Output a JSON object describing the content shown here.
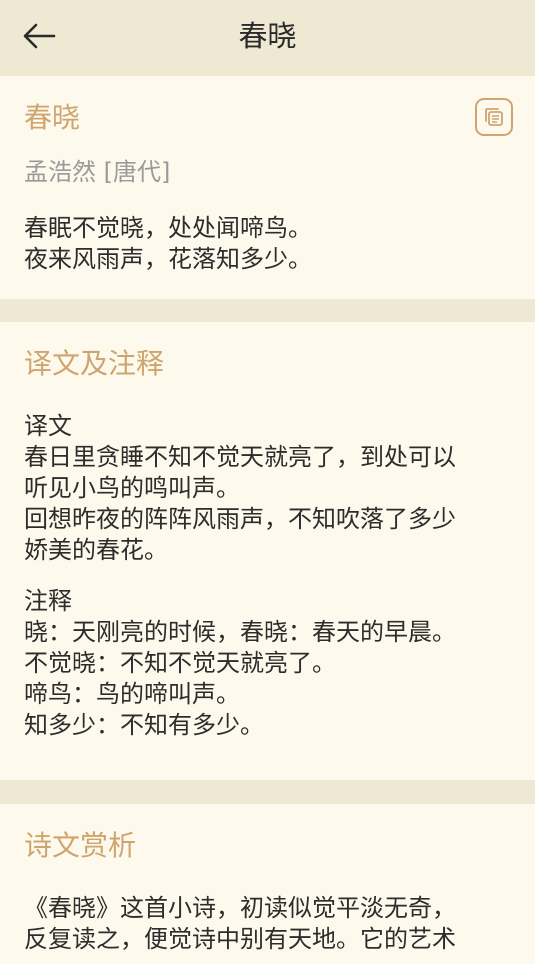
{
  "header": {
    "title": "春晓"
  },
  "poem": {
    "title": "春晓",
    "author": "孟浩然 [唐代]",
    "lines": [
      "春眠不觉晓，处处闻啼鸟。",
      "夜来风雨声，花落知多少。"
    ]
  },
  "translation_section": {
    "heading": "译文及注释",
    "translation_label": "译文",
    "translation_lines": [
      "春日里贪睡不知不觉天就亮了，到处可以",
      "听见小鸟的鸣叫声。",
      "回想昨夜的阵阵风雨声，不知吹落了多少",
      "娇美的春花。"
    ],
    "notes_label": "注释",
    "notes_lines": [
      "晓：天刚亮的时候，春晓：春天的早晨。",
      "不觉晓：不知不觉天就亮了。",
      "啼鸟：鸟的啼叫声。",
      "知多少：不知有多少。"
    ]
  },
  "appreciation_section": {
    "heading": "诗文赏析",
    "lines": [
      "《春晓》这首小诗，初读似觉平淡无奇，",
      "反复读之，便觉诗中别有天地。它的艺术"
    ]
  },
  "colors": {
    "accent": "#cfa56f",
    "background": "#efe9d3",
    "card": "#fdf9ec"
  }
}
